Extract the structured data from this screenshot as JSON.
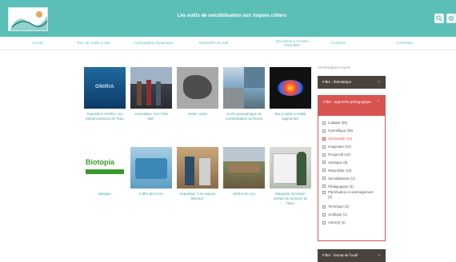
{
  "header": {
    "title": "Les outils de sensibilisation aux risques côtiers",
    "search_icon": "search-icon",
    "user_icon": "gear-icon"
  },
  "nav": {
    "items": [
      "Accueil",
      "Tous les outils (Liste)",
      "Cartographie dynamique",
      "Soumettre un outil",
      "Inscription à la lettre d'actualité",
      "Contacts",
      "Connectez"
    ]
  },
  "results": "19 Résultats trouvés",
  "cards": [
    {
      "caption": "Exposition ONIRIA, les Métamorphoses de l'Eau",
      "thumb_text": "ONIRIA"
    },
    {
      "caption": "Association \"Les Fatis Mar\""
    },
    {
      "caption": "Atelier cartes"
    },
    {
      "caption": "Accès panoramique de sensibilisation au littoral"
    },
    {
      "caption": "Bac à sable à réalité augmentée"
    },
    {
      "caption": "Biotopia",
      "thumb_text": "Biotopia"
    },
    {
      "caption": "Coffre de la mer"
    },
    {
      "caption": "Exposition \"Les risques littoraux\""
    },
    {
      "caption": "Jardins de Léo"
    },
    {
      "caption": "Maquette du bassin versant du territoire de l'Eau"
    }
  ],
  "filters": {
    "thematique": "Filtre : thématique",
    "approche": "Filtre : approche pédagogique",
    "format": "Filtre : format de l'outil",
    "options": [
      {
        "label": "Ludique (35)",
        "checked": false
      },
      {
        "label": "Scientifique (38)",
        "checked": false
      },
      {
        "label": "Sensorielle (13)",
        "checked": true
      },
      {
        "label": "Imaginaire (10)",
        "checked": false
      },
      {
        "label": "Prospectif (10)",
        "checked": false
      },
      {
        "label": "Artistique (8)",
        "checked": false
      },
      {
        "label": "Naturaliste (13)",
        "checked": false
      },
      {
        "label": "Sensibilisation (1)",
        "checked": false
      },
      {
        "label": "Pédagogique (2)",
        "checked": false
      },
      {
        "label": "Planification et aménagement (2)",
        "checked": false
      },
      {
        "label": "Technique (3)",
        "checked": false
      },
      {
        "label": "Juridique (1)",
        "checked": false
      },
      {
        "label": "Autre(s) (4)",
        "checked": false
      }
    ]
  },
  "colors": {
    "teal": "#5bbfb7",
    "dark": "#4a423c",
    "red": "#d9534f"
  }
}
